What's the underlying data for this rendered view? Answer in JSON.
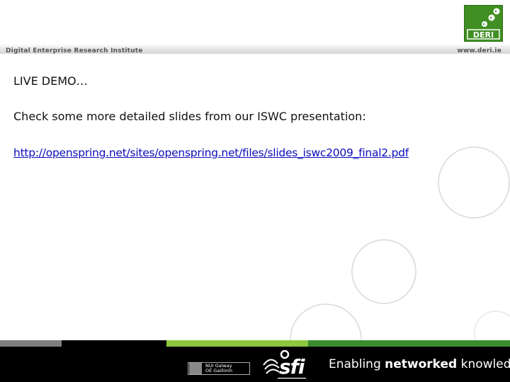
{
  "header": {
    "left_text": "Digital Enterprise Research Institute",
    "right_text": "www.deri.ie"
  },
  "logo": {
    "text": "DERI"
  },
  "content": {
    "line1": "LIVE DEMO…",
    "line2": "Check some more detailed slides from our ISWC presentation:",
    "link": "http://openspring.net/sites/openspring.net/files/slides_iswc2009_final2.pdf"
  },
  "footer": {
    "nui_line1": "NUI Galway",
    "nui_line2": "OÉ Gaillimh",
    "sfi_text": "sfi",
    "tagline_part1": "Enabling ",
    "tagline_bold": "networked",
    "tagline_part2": " knowledge."
  },
  "colors": {
    "green_dark": "#3a8c2f",
    "green_light": "#8dc63f",
    "link": "#0b0bbb"
  }
}
